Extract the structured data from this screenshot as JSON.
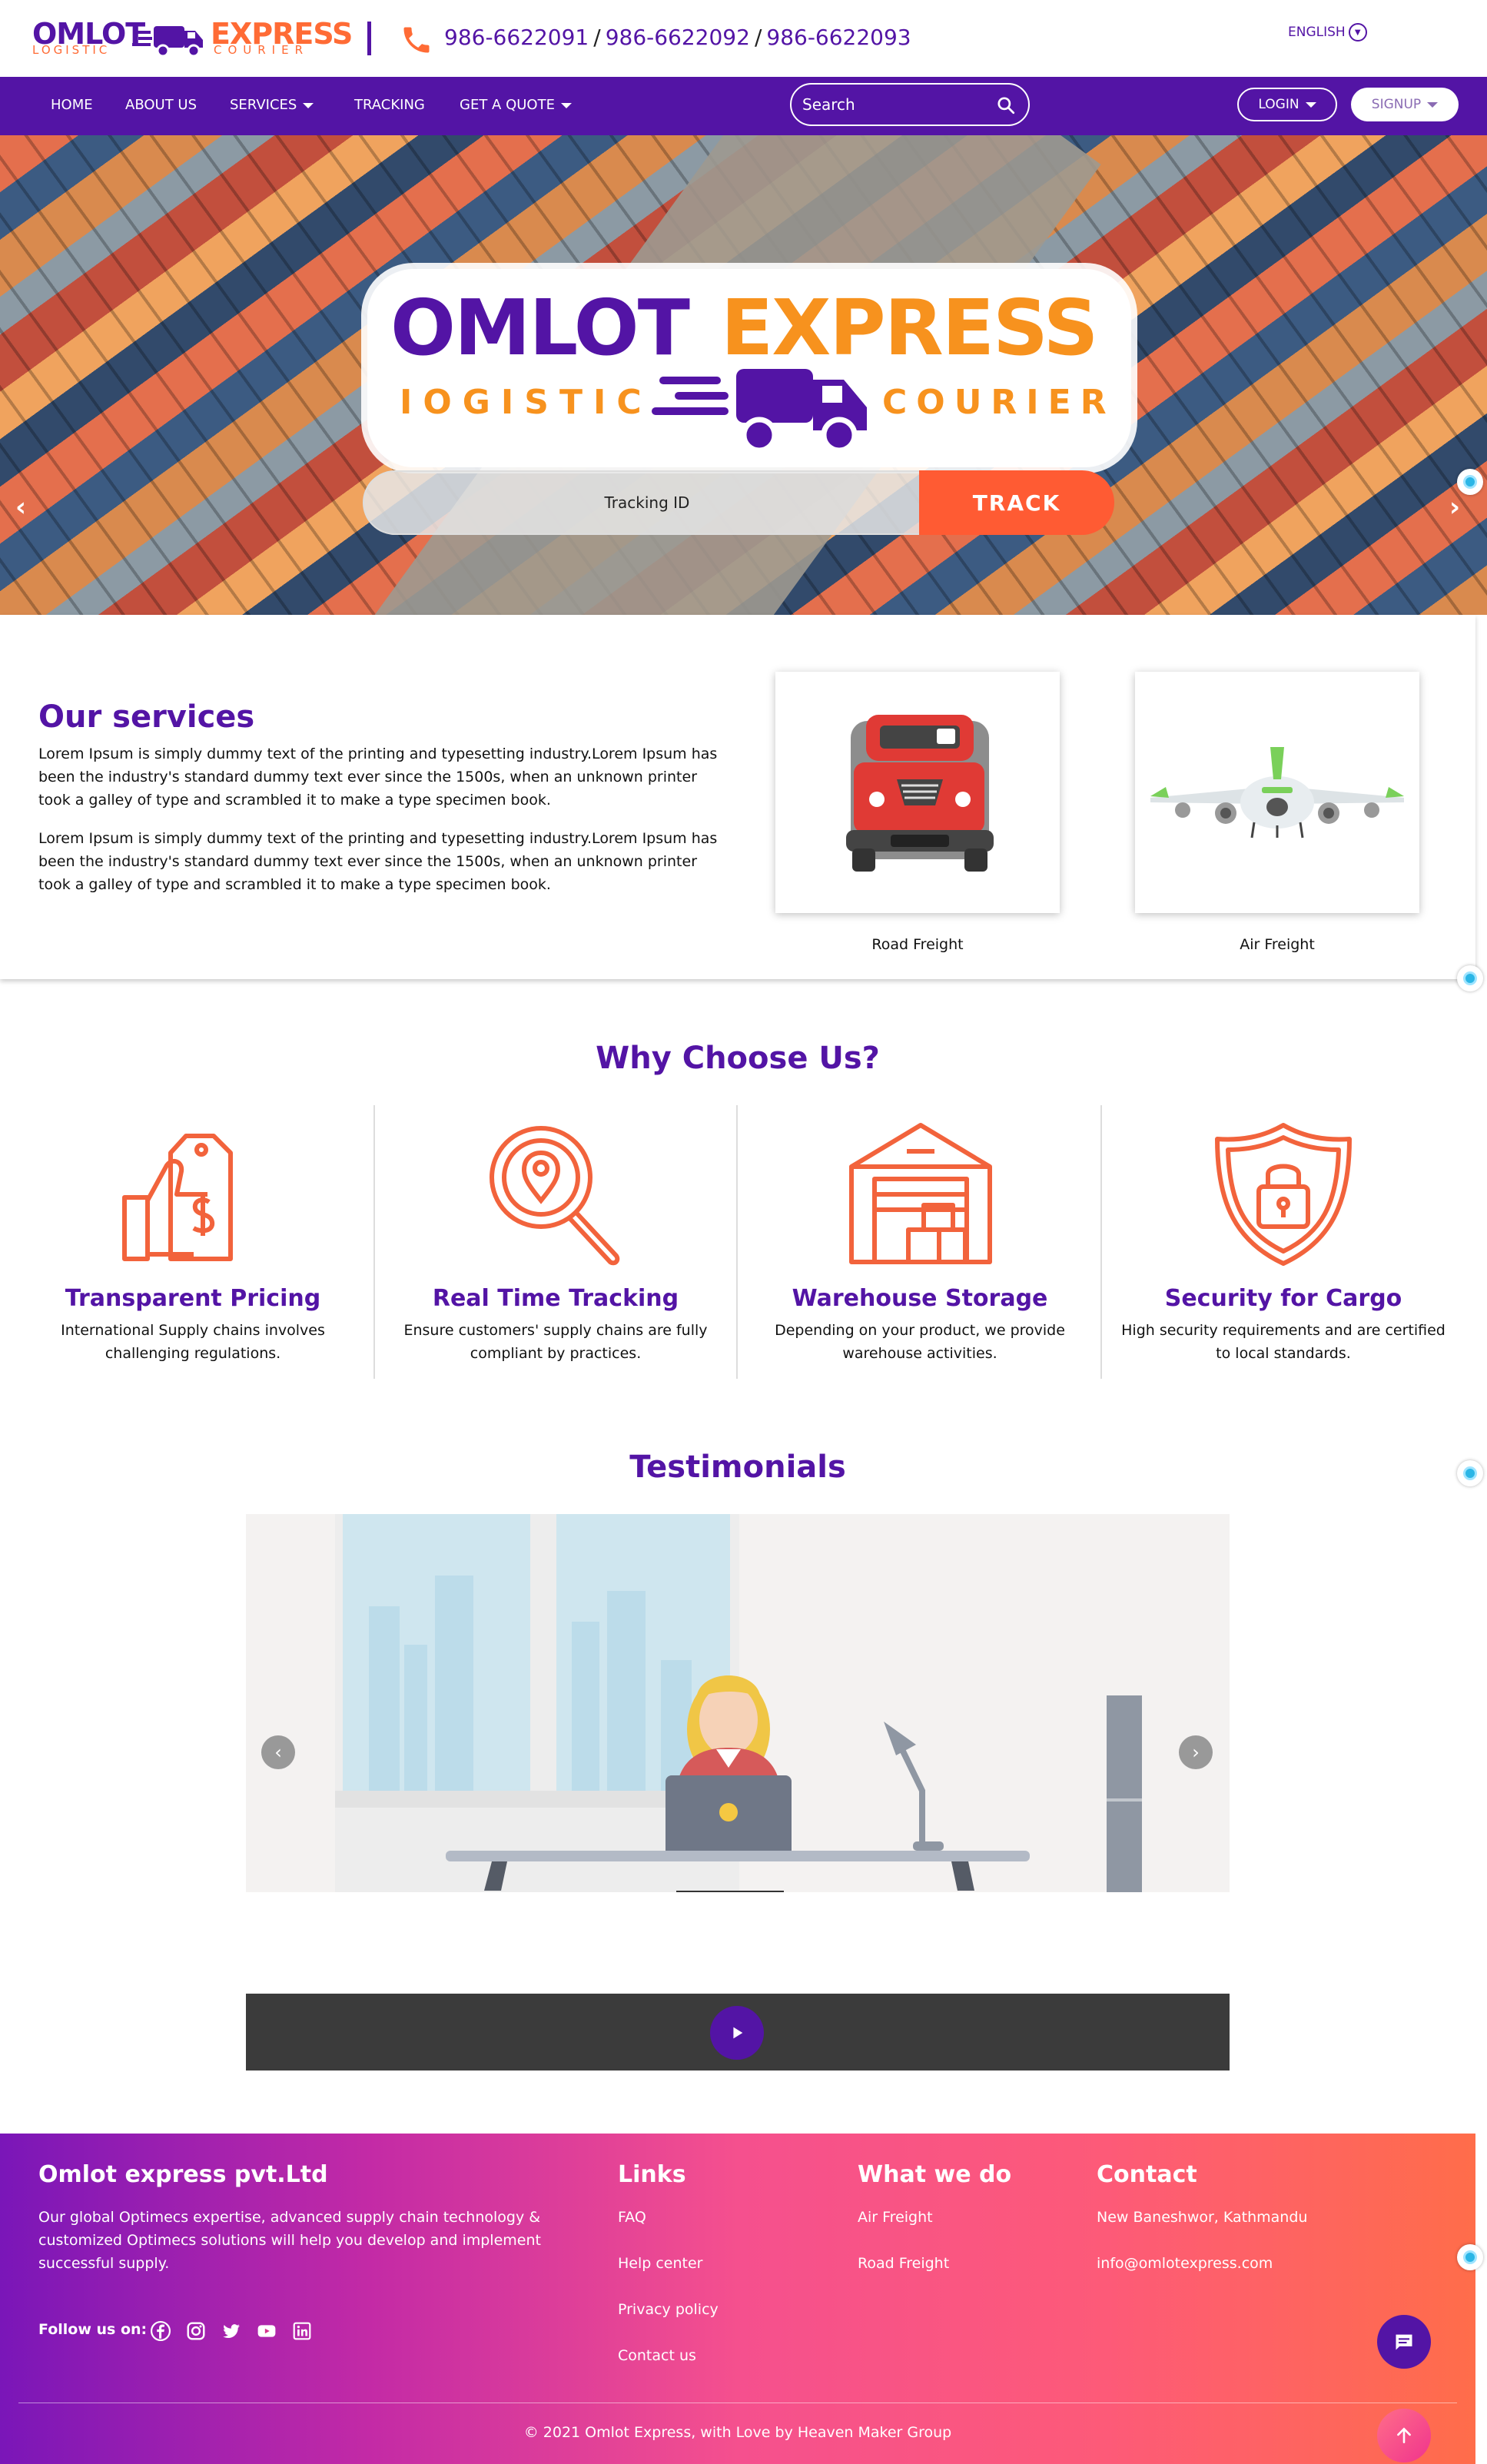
{
  "brand": {
    "logo_word1": "OMLOT",
    "logo_word2": "EXPRESS",
    "logo_sub1": "LOGISTIC",
    "logo_sub2": "COURIER",
    "purple": "#5314a5",
    "orange": "#ff6b35"
  },
  "header": {
    "phones": [
      "986-6622091",
      "986-6622092",
      "986-6622093"
    ],
    "phone_icon": "phone-icon",
    "language": "ENGLISH"
  },
  "nav": {
    "items": [
      {
        "label": "HOME"
      },
      {
        "label": "ABOUT US"
      },
      {
        "label": "SERVICES",
        "dropdown": true
      },
      {
        "label": "TRACKING"
      },
      {
        "label": "GET A QUOTE",
        "dropdown": true
      }
    ],
    "search_placeholder": "Search",
    "login": "LOGIN",
    "signup": "SIGNUP"
  },
  "hero": {
    "title1": "OMLOT",
    "title2": "EXPRESS",
    "sub1": "IOGISTIC",
    "sub2": "COURIER",
    "tracking_placeholder": "Tracking ID",
    "track_button": "TRACK"
  },
  "services": {
    "title": "Our services",
    "paragraphs": [
      "Lorem Ipsum is simply dummy text of the printing and typesetting industry.Lorem Ipsum has been the industry's standard dummy text ever since the 1500s, when an unknown printer took a galley of type and scrambled it to make a type specimen book.",
      "Lorem Ipsum is simply dummy text of the printing and typesetting industry.Lorem Ipsum has been the industry's standard dummy text ever since the 1500s, when an unknown printer took a galley of type and scrambled it to make a type specimen book."
    ],
    "cards": [
      {
        "label": "Road Freight",
        "icon": "truck-icon"
      },
      {
        "label": "Air Freight",
        "icon": "airplane-icon"
      }
    ]
  },
  "why": {
    "title": "Why Choose Us?",
    "items": [
      {
        "title": "Transparent Pricing",
        "text": "International Supply chains involves challenging regulations.",
        "icon": "thumbs-up-price-tag-icon"
      },
      {
        "title": "Real Time Tracking",
        "text": "Ensure customers' supply chains are fully compliant by practices.",
        "icon": "magnifier-location-icon"
      },
      {
        "title": "Warehouse Storage",
        "text": "Depending on your product, we provide warehouse activities.",
        "icon": "warehouse-icon"
      },
      {
        "title": "Security for Cargo",
        "text": "High security requirements and are certified to local standards.",
        "icon": "shield-lock-icon"
      }
    ]
  },
  "testimonials": {
    "title": "Testimonials"
  },
  "footer": {
    "company": "Omlot express pvt.Ltd",
    "about": "Our global Optimecs expertise, advanced supply chain technology & customized Optimecs solutions will help you develop and implement successful supply.",
    "follow": "Follow us on:",
    "social": [
      "facebook-icon",
      "instagram-icon",
      "twitter-icon",
      "youtube-icon",
      "linkedin-icon"
    ],
    "links_title": "Links",
    "links": [
      "FAQ",
      "Help center",
      "Privacy policy",
      "Contact us"
    ],
    "what_title": "What we do",
    "what": [
      "Air Freight",
      "Road Freight"
    ],
    "contact_title": "Contact",
    "address": "New Baneshwor, Kathmandu",
    "email": "info@omlotexpress.com",
    "copyright": "© 2021 Omlot Express, with Love by Heaven Maker Group"
  }
}
